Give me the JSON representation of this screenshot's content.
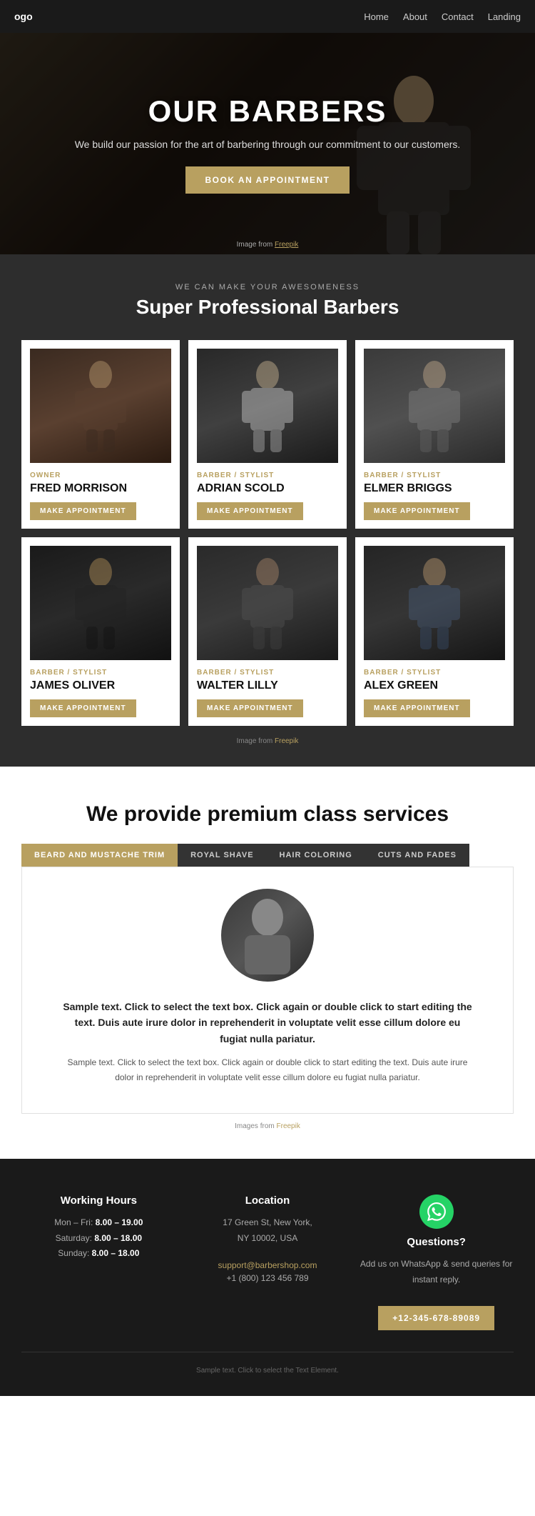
{
  "nav": {
    "logo": "ogo",
    "links": [
      "Home",
      "About",
      "Contact",
      "Landing"
    ]
  },
  "hero": {
    "title": "OUR BARBERS",
    "subtitle": "We build our passion for the art of barbering through\nour commitment to our customers.",
    "cta_label": "BOOK AN APPOINTMENT",
    "credit_text": "Image from ",
    "credit_link": "Freepik"
  },
  "barbers_section": {
    "label": "WE CAN MAKE YOUR AWESOMENESS",
    "title": "Super Professional Barbers",
    "barbers": [
      {
        "id": "fred",
        "role": "OWNER",
        "name": "FRED MORRISON",
        "btn": "MAKE APPOINTMENT"
      },
      {
        "id": "adrian",
        "role": "BARBER / STYLIST",
        "name": "ADRIAN SCOLD",
        "btn": "MAKE APPOINTMENT"
      },
      {
        "id": "elmer",
        "role": "BARBER / STYLIST",
        "name": "ELMER BRIGGS",
        "btn": "MAKE APPOINTMENT"
      },
      {
        "id": "james",
        "role": "BARBER / STYLIST",
        "name": "JAMES OLIVER",
        "btn": "MAKE APPOINTMENT"
      },
      {
        "id": "walter",
        "role": "BARBER / STYLIST",
        "name": "WALTER LILLY",
        "btn": "MAKE APPOINTMENT"
      },
      {
        "id": "alex",
        "role": "BARBER / STYLIST",
        "name": "ALEX GREEN",
        "btn": "MAKE APPOINTMENT"
      }
    ],
    "credit_text": "Image from ",
    "credit_link": "Freepik"
  },
  "services_section": {
    "title": "We provide premium class services",
    "tabs": [
      {
        "id": "beard",
        "label": "BEARD AND MUSTACHE TRIM",
        "active": true
      },
      {
        "id": "shave",
        "label": "ROYAL SHAVE",
        "active": false
      },
      {
        "id": "coloring",
        "label": "HAIR COLORING",
        "active": false
      },
      {
        "id": "cuts",
        "label": "CUTS AND FADES",
        "active": false
      }
    ],
    "content": {
      "text_main": "Sample text. Click to select the text box. Click again or double click to start editing the text. Duis aute irure dolor in reprehenderit in voluptate velit esse cillum dolore eu fugiat nulla pariatur.",
      "text_sub": "Sample text. Click to select the text box. Click again or double click to start editing the text. Duis aute irure dolor in reprehenderit in voluptate velit esse cillum dolore eu fugiat nulla pariatur."
    },
    "credit_text": "Images from ",
    "credit_link": "Freepik"
  },
  "footer": {
    "working_hours": {
      "title": "Working Hours",
      "rows": [
        {
          "day": "Mon – Fri:",
          "hours": "8.00 – 19.00"
        },
        {
          "day": "Saturday:",
          "hours": "8.00 – 18.00"
        },
        {
          "day": "Sunday:",
          "hours": "8.00 – 18.00"
        }
      ]
    },
    "location": {
      "title": "Location",
      "address1": "17 Green St, New York,",
      "address2": "NY 10002, USA",
      "email": "support@barbershop.com",
      "phone": "+1 (800) 123 456 789"
    },
    "questions": {
      "title": "Questions?",
      "text": "Add us on WhatsApp & send\nqueries for instant reply.",
      "phone_btn": "+12-345-678-89089"
    },
    "bottom_text": "Sample text. Click to select the Text Element."
  }
}
